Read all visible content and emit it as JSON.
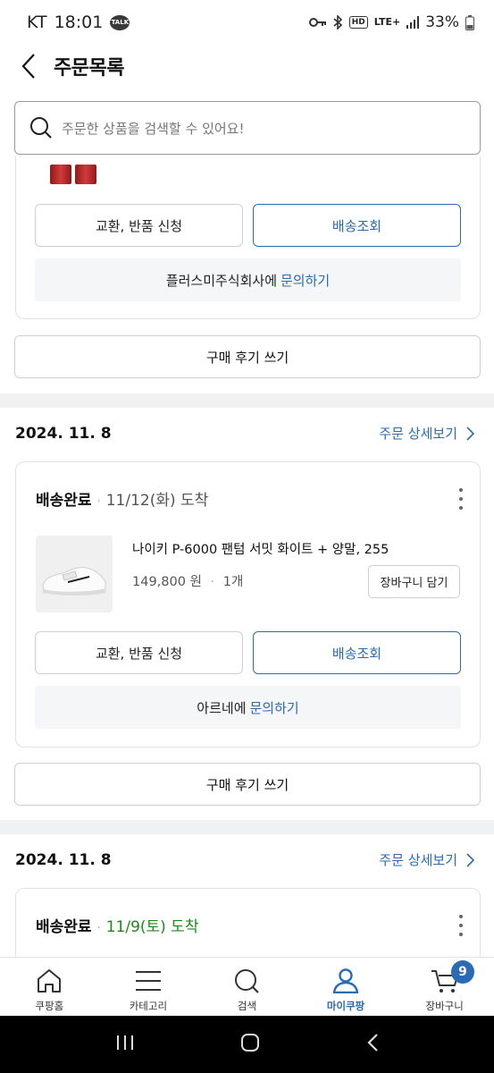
{
  "status_bar": {
    "carrier": "KT",
    "time": "18:01",
    "talk_label": "TALK",
    "lte": "LTE+",
    "battery": "33%"
  },
  "header": {
    "title": "주문목록"
  },
  "search": {
    "placeholder": "주문한 상품을 검색할 수 있어요!"
  },
  "orders": [
    {
      "actions": {
        "exchange": "교환, 반품 신청",
        "track": "배송조회"
      },
      "inquiry": {
        "seller": "플러스미주식회사에",
        "link": "문의하기"
      },
      "review": "구매 후기 쓰기"
    },
    {
      "date": "2024. 11. 8",
      "detail_link": "주문 상세보기",
      "status": "배송완료",
      "arrival": "11/12(화) 도착",
      "product_name": "나이키 P-6000 팬텀 서밋 화이트 + 양말, 255",
      "price": "149,800 원",
      "qty": "1개",
      "cart_btn": "장바구니 담기",
      "actions": {
        "exchange": "교환, 반품 신청",
        "track": "배송조회"
      },
      "inquiry": {
        "seller": "아르네에",
        "link": "문의하기"
      },
      "review": "구매 후기 쓰기"
    },
    {
      "date": "2024. 11. 8",
      "detail_link": "주문 상세보기",
      "status": "배송완료",
      "arrival": "11/9(토) 도착"
    }
  ],
  "bottom_nav": [
    {
      "label": "쿠팡홈",
      "icon": "home-icon"
    },
    {
      "label": "카테고리",
      "icon": "menu-icon"
    },
    {
      "label": "검색",
      "icon": "search-icon"
    },
    {
      "label": "마이쿠팡",
      "icon": "user-icon",
      "active": true
    },
    {
      "label": "장바구니",
      "icon": "cart-icon",
      "badge": "9"
    }
  ],
  "colors": {
    "accent": "#2a6bb3",
    "arrival_green": "#1b8a1b",
    "divider": "#f0f1f3"
  }
}
